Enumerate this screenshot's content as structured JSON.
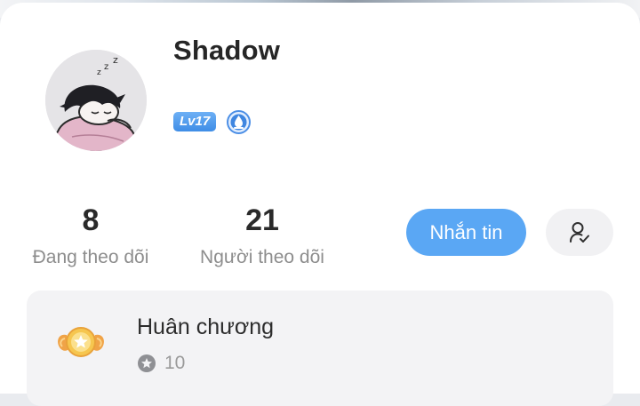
{
  "profile": {
    "username": "Shadow",
    "level_badge": "Lv17",
    "avatar_icon": "sleeping-character-avatar",
    "vip_icon": "blue-drop-badge-icon"
  },
  "stats": {
    "following": {
      "value": "8",
      "label": "Đang theo dõi"
    },
    "followers": {
      "value": "21",
      "label": "Người theo dõi"
    }
  },
  "actions": {
    "message_label": "Nhắn tin",
    "follow_status_icon": "user-check-icon"
  },
  "medals": {
    "title": "Huân chương",
    "count": "10",
    "medal_icon": "winged-medal-icon",
    "count_icon": "star-circle-icon"
  },
  "colors": {
    "accent": "#5aa7f4",
    "level_badge": "#4c98ec",
    "panel_background": "#f3f3f5",
    "secondary_text": "#8d8d8d"
  }
}
